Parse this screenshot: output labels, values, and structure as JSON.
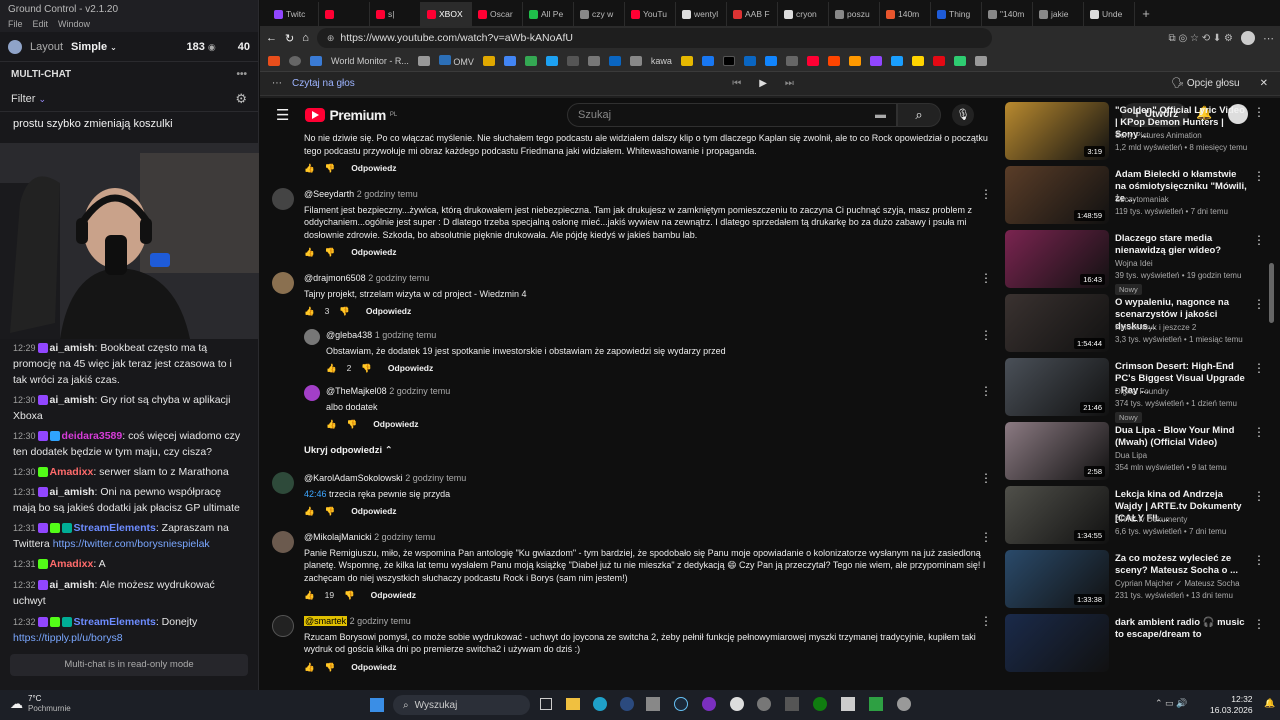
{
  "left_app": {
    "title": "Ground Control - v2.1.20",
    "menu": [
      "File",
      "Edit",
      "Window"
    ],
    "layout_label": "Layout",
    "layout_value": "Simple",
    "viewer_count": "183",
    "viewer_count_2": "40",
    "section": "MULTI-CHAT",
    "filter": "Filter",
    "top_message": "prostu szybko zmieniają koszulki",
    "readonly": "Multi-chat is in read-only mode",
    "messages": [
      {
        "time": "12:29",
        "user": "ai_amish",
        "color": "#ffffff",
        "text": "Bookbeat często ma tą promocję na 45 więc jak teraz jest czasowa to i tak wróci za jakiś czas.",
        "link": ""
      },
      {
        "time": "12:30",
        "user": "ai_amish",
        "color": "#ffffff",
        "text": "Gry riot są chyba w aplikacji Xboxa",
        "link": ""
      },
      {
        "time": "12:30",
        "user": "deidara3589",
        "color": "#d63cd8",
        "text": "coś więcej wiadomo czy ten dodatek będzie w tym maju, czy cisza?",
        "link": ""
      },
      {
        "time": "12:30",
        "user": "Amadixx",
        "color": "#ff6b6b",
        "text": "serwer slam to z Marathona",
        "link": ""
      },
      {
        "time": "12:31",
        "user": "ai_amish",
        "color": "#ffffff",
        "text": "Oni na pewno współpracę mają bo są jakieś dodatki jak płacisz GP ultimate",
        "link": ""
      },
      {
        "time": "12:31",
        "user": "StreamElements",
        "color": "#6d8cff",
        "text": "Zapraszam na Twittera",
        "link": "https://twitter.com/borysniespielak"
      },
      {
        "time": "12:31",
        "user": "Amadixx",
        "color": "#ff6b6b",
        "text": "A",
        "link": ""
      },
      {
        "time": "12:32",
        "user": "ai_amish",
        "color": "#ffffff",
        "text": "Ale możesz wydrukować uchwyt",
        "link": ""
      },
      {
        "time": "12:32",
        "user": "StreamElements",
        "color": "#6d8cff",
        "text": "Donejty",
        "link": "https://tipply.pl/u/borys8"
      }
    ]
  },
  "browser": {
    "tabs": [
      {
        "label": "Twitc",
        "color": "#9146ff"
      },
      {
        "label": "",
        "color": "#ff0033"
      },
      {
        "label": "s|",
        "color": "#ff0033"
      },
      {
        "label": "XBOX",
        "color": "#ff0033",
        "active": true
      },
      {
        "label": "Oscar",
        "color": "#ff0033"
      },
      {
        "label": "All Pe",
        "color": "#1fbf4a"
      },
      {
        "label": "czy w",
        "color": "#888"
      },
      {
        "label": "YouTu",
        "color": "#ff0033"
      },
      {
        "label": "wentyl",
        "color": "#dddddd"
      },
      {
        "label": "AAB F",
        "color": "#d33"
      },
      {
        "label": "cryon",
        "color": "#dddddd"
      },
      {
        "label": "poszu",
        "color": "#888"
      },
      {
        "label": "140m",
        "color": "#e8552d"
      },
      {
        "label": "Thing",
        "color": "#1e5bd8"
      },
      {
        "label": "\"140m",
        "color": "#888"
      },
      {
        "label": "jakie",
        "color": "#888"
      },
      {
        "label": "Unde",
        "color": "#dddddd"
      }
    ],
    "url": "https://www.youtube.com/watch?v=aWb-kANoAfU",
    "bookmark_folder": "World Monitor - R...",
    "bookmark_omv": "OMV",
    "bookmark_kawa": "kawa",
    "read_aloud": "Czytaj na głos",
    "voice_options": "Opcje głosu"
  },
  "youtube": {
    "logo": "Premium",
    "logo_region": "PL",
    "search_placeholder": "Szukaj",
    "create": "Utwórz",
    "reply_label": "Odpowiedz",
    "hide_replies": "Ukryj odpowiedzi",
    "comments": [
      {
        "author": "",
        "time": "",
        "text": "No nie dziwie się. Po co włączać myślenie. Nie słuchałem tego podcastu ale widziałem dalszy klip o tym dlaczego Kaplan się zwolnił, ale to co Rock opowiedział o początku tego podcastu przywołuje mi obraz każdego podcastu Friedmana jaki widziałem. Whitewashowanie i propaganda.",
        "likes": ""
      },
      {
        "author": "@Seeydarth",
        "time": "2 godziny temu",
        "text": "Filament jest bezpieczny...żywica, którą drukowałem jest niebezpieczna. Tam jak drukujesz w zamkniętym pomieszczeniu to zaczyna Ci puchnąć szyja, masz problem z oddychaniem...ogólnie jest super : D dlatego trzeba specjalną osłonę mieć...jakiś wywiew na zewnątrz. I dlatego sprzedałem tą drukarkę bo za dużo zabawy i psuła mi dosłownie zdrowie. Szkoda, bo absolutnie pięknie drukowała. Ale pójdę kiedyś w jakieś bambu lab.",
        "likes": ""
      },
      {
        "author": "@drajmon6508",
        "time": "2 godziny temu",
        "text": "Tajny projekt, strzelam wizyta w cd project - Wiedzmin 4",
        "likes": "3"
      },
      {
        "author": "@gleba438",
        "time": "1 godzinę temu",
        "text": "Obstawiam, że dodatek 19 jest spotkanie inwestorskie i obstawiam że zapowiedzi się wydarzy przed",
        "likes": "2"
      },
      {
        "author": "@TheMajkel08",
        "time": "2 godziny temu",
        "text": "albo dodatek",
        "likes": ""
      },
      {
        "author": "@KarolAdamSokolowski",
        "time": "2 godziny temu",
        "timestamp": "42:46",
        "text": "trzecia ręka pewnie się przyda",
        "likes": ""
      },
      {
        "author": "@MikolajManicki",
        "time": "2 godziny temu",
        "text": "Panie Remigiuszu, miło, że wspomina Pan antologię \"Ku gwiazdom\" - tym bardziej, że spodobało się Panu moje opowiadanie o kolonizatorze wysłanym na już zasiedloną planetę. Wspomnę, że kilka lat temu wysłałem Panu moją książkę \"Diabeł już tu nie mieszka\" z dedykacją 😄 Czy Pan ją przeczytał? Tego nie wiem, ale przypominam się! I zachęcam do niej wszystkich słuchaczy podcastu Rock i Borys (sam nim jestem!)",
        "likes": "19"
      },
      {
        "author": "@smartek",
        "time": "2 godziny temu",
        "text": "Rzucam Borysowi pomysł, co może sobie wydrukować - uchwyt do joycona ze switcha 2, żeby pełnił funkcję pełnowymiarowej myszki trzymanej tradycyjnie, kupiłem taki wydruk od gościa kilka dni po premierze switcha2 i używam do dziś :)",
        "likes": ""
      }
    ],
    "sidebar": [
      {
        "title": "\"Golden\" Official Lyric Video | KPop Demon Hunters | Sony ...",
        "channel": "Sony Pictures Animation",
        "meta": "1,2 mld wyświetleń • 8 miesięcy temu",
        "duration": "3:19",
        "badge": "",
        "thumb": "#b98a2f"
      },
      {
        "title": "Adam Bielecki o kłamstwie na ośmiotysięczniku \"Mówili, że ...",
        "channel": "Szczytomaniak",
        "meta": "119 tys. wyświetleń • 7 dni temu",
        "duration": "1:48:59",
        "badge": "",
        "thumb": "#5a3d28"
      },
      {
        "title": "Dlaczego stare media nienawidzą gier wideo?",
        "channel": "Wojna Idei",
        "meta": "39 tys. wyświetleń • 19 godzin temu",
        "duration": "16:43",
        "badge": "Nowy",
        "thumb": "#7a2450"
      },
      {
        "title": "O wypaleniu, nagonce na scenarzystów i jakości dyskus...",
        "channel": "Kinocentryk i jeszcze 2",
        "meta": "3,3 tys. wyświetleń • 1 miesiąc temu",
        "duration": "1:54:44",
        "badge": "",
        "thumb": "#3a3230"
      },
      {
        "title": "Crimson Desert: High-End PC's Biggest Visual Upgrade - Ray ...",
        "channel": "Digital Foundry",
        "meta": "374 tys. wyświetleń • 1 dzień temu",
        "duration": "21:46",
        "badge": "Nowy",
        "thumb": "#4a5058"
      },
      {
        "title": "Dua Lipa - Blow Your Mind (Mwah) (Official Video)",
        "channel": "Dua Lipa",
        "meta": "354 mln wyświetleń • 9 lat temu",
        "duration": "2:58",
        "badge": "",
        "thumb": "#8b7a82"
      },
      {
        "title": "Lekcja kina od Andrzeja Wajdy | ARTE.tv Dokumenty [CAŁY FIL...",
        "channel": "ARTE.tv Dokumenty",
        "meta": "6,6 tys. wyświetleń • 7 dni temu",
        "duration": "1:34:55",
        "badge": "",
        "thumb": "#50504a"
      },
      {
        "title": "Za co możesz wylecieć ze sceny? Mateusz Socha o ...",
        "channel": "Cyprian Majcher ✓ Mateusz Socha",
        "meta": "231 tys. wyświetleń • 13 dni temu",
        "duration": "1:33:38",
        "badge": "",
        "thumb": "#2a4a6a"
      },
      {
        "title": "dark ambient radio 🎧 music to escape/dream to",
        "channel": "",
        "meta": "",
        "duration": "",
        "badge": "",
        "thumb": "#1a2a4a"
      }
    ]
  },
  "taskbar": {
    "weather_temp": "7°C",
    "weather_desc": "Pochmurnie",
    "search": "Wyszukaj",
    "time": "12:32",
    "date": "16.03.2026"
  },
  "colors": {
    "yt_red": "#ff0033",
    "twitch_purple": "#9146ff"
  }
}
